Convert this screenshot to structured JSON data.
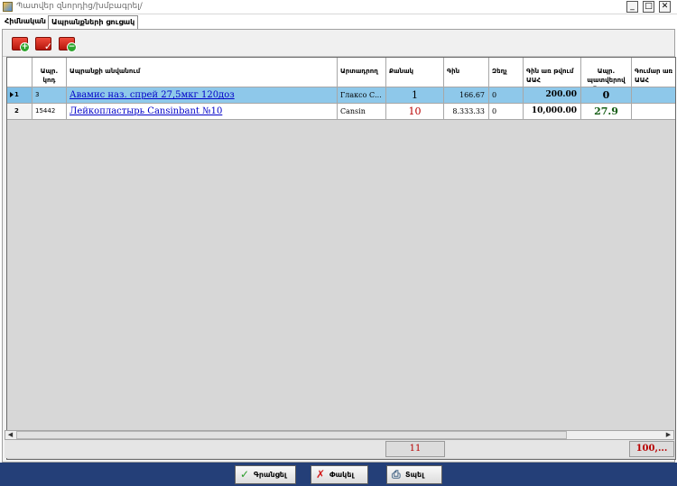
{
  "window": {
    "title": "Պատվեր զնորդից/խմբագրել/"
  },
  "tabs": [
    {
      "label": "Հիմնական"
    },
    {
      "label": "Ապրանքների ցուցակ"
    }
  ],
  "table": {
    "headers": [
      "",
      "Ապր. կոդ",
      "Ապրանքի անվանում",
      "Արտադրող",
      "Քանակ",
      "Գին",
      "Զեղչ",
      "Գին առ թվում ԱԱՀ",
      "Ապր. պատվերով մնացորդ",
      "Գումար առ ԱԱՀ"
    ],
    "rows": [
      {
        "num": "1",
        "code": "3",
        "name": "Авамис наз. спрей 27,5мкг 120доз",
        "maker": "Глаксо С...",
        "qty": "1",
        "price": "166.67",
        "discount": "0",
        "price_vat": "200.00",
        "remaining": "0",
        "sum": ""
      },
      {
        "num": "2",
        "code": "15442",
        "name": "Лейкопластырь Cansinbant №10",
        "maker": "Cansin",
        "qty": "10",
        "price": "8.333.33",
        "discount": "0",
        "price_vat": "10,000.00",
        "remaining": "27.9",
        "sum": ""
      }
    ]
  },
  "totals": {
    "qty": "11",
    "sum": "100,..."
  },
  "buttons": {
    "confirm": "Գրանցել",
    "close": "Փակել",
    "print": "Տպել"
  },
  "colors": {
    "selected_row": "#8ec8ea",
    "footer_bar": "#243f78",
    "quantity_red": "#b80000",
    "remaining_green": "#135c13"
  }
}
